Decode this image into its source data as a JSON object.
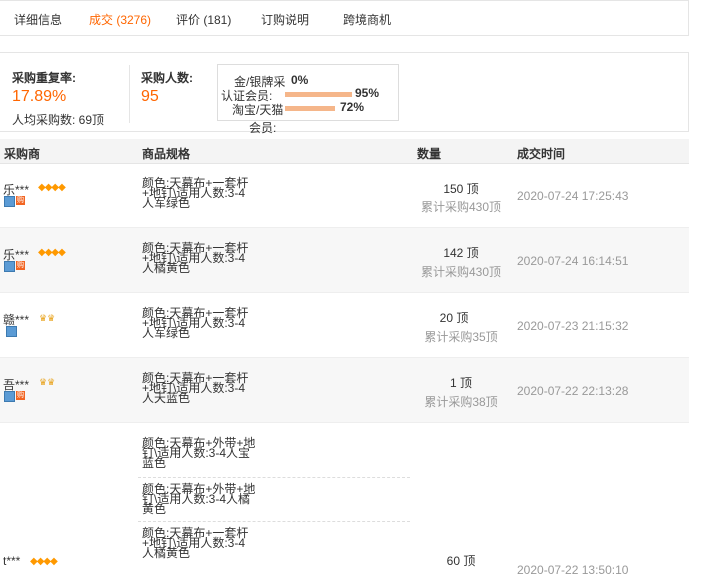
{
  "tabs": [
    "详细信息",
    "成交 (3276)",
    "评价 (181)",
    "订购说明",
    "跨境商机"
  ],
  "summary": {
    "repurchase_label": "采购重复率:",
    "repurchase_value": "17.89%",
    "avg_label": "人均采购数: 69顶",
    "buyers_label": "采购人数:",
    "buyers_value": "95",
    "ratios": [
      {
        "label": "金/银牌采",
        "value": "0%",
        "fraction": 0.0
      },
      {
        "label": "认证会员:",
        "value": "95%",
        "fraction": 0.95
      },
      {
        "label": "淘宝/天猫",
        "value": "72%",
        "fraction": 0.72
      }
    ],
    "ratio_extra": "会员:"
  },
  "table": {
    "headers": [
      "采购商",
      "商品规格",
      "数量",
      "成交时间"
    ],
    "rows": [
      {
        "buyer": "乐***",
        "spec": "颜色:天幕布+一套杆+地钉\\适用人数:3-4人军绿色",
        "qty": "150 顶",
        "cumulative": "累计采购430顶",
        "time": "2020-07-24 17:25:43"
      },
      {
        "buyer": "乐***",
        "spec": "颜色:天幕布+一套杆+地钉\\适用人数:3-4人橘黄色",
        "qty": "142 顶",
        "cumulative": "累计采购430顶",
        "time": "2020-07-24 16:14:51"
      },
      {
        "buyer": "赣***",
        "spec": "颜色:天幕布+一套杆+地钉\\适用人数:3-4人军绿色",
        "qty": "20 顶",
        "cumulative": "累计采购35顶",
        "time": "2020-07-23 21:15:32"
      },
      {
        "buyer": "吾***",
        "spec": "颜色:天幕布+一套杆+地钉\\适用人数:3-4人天蓝色",
        "qty": "1 顶",
        "cumulative": "累计采购38顶",
        "time": "2020-07-22 22:13:28"
      }
    ],
    "last_row": {
      "buyer": "t***",
      "specs": [
        "颜色:天幕布+外带+地钉\\适用人数:3-4人宝蓝色",
        "颜色:天幕布+外带+地钉\\适用人数:3-4人橘黄色",
        "颜色:天幕布+一套杆+地钉\\适用人数:3-4人橘黄色"
      ],
      "qty": "60 顶",
      "time": "2020-07-22 13:50:10"
    }
  },
  "badges": {
    "membership": "购"
  },
  "colors": {
    "accent": "#ff6600",
    "bar": "#f5b68a",
    "muted": "#999999"
  }
}
